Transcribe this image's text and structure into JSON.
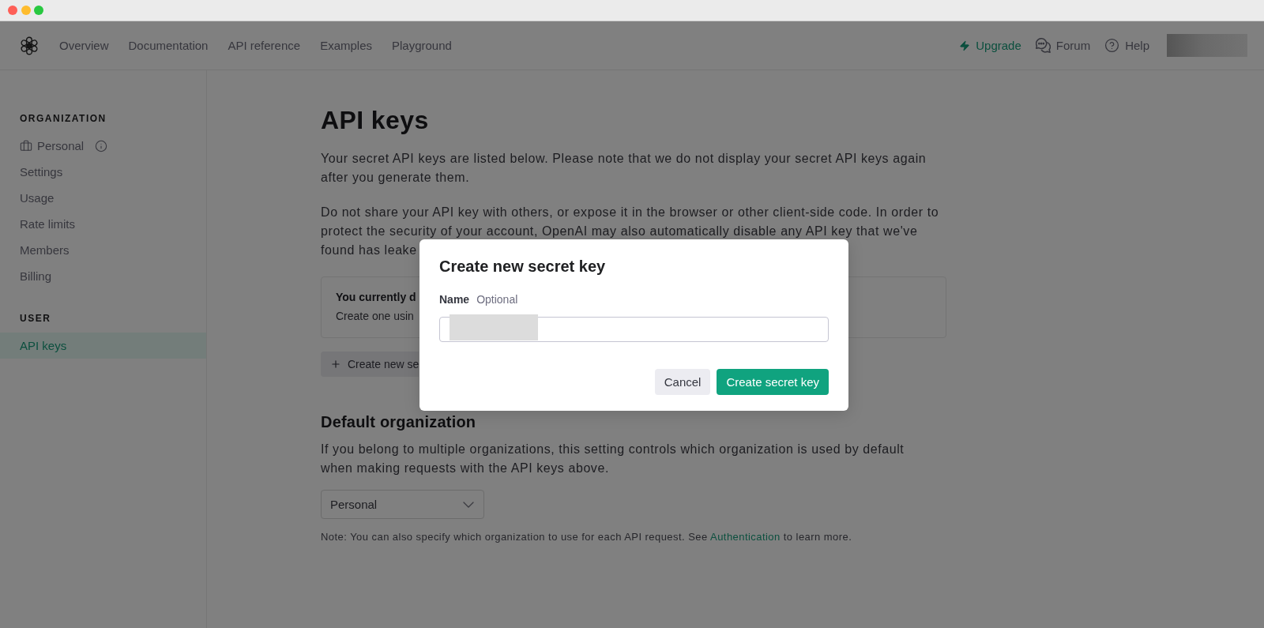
{
  "nav": {
    "links": [
      "Overview",
      "Documentation",
      "API reference",
      "Examples",
      "Playground"
    ],
    "actions": [
      {
        "kind": "upgrade",
        "label": "Upgrade"
      },
      {
        "kind": "forum",
        "label": "Forum"
      },
      {
        "kind": "help",
        "label": "Help"
      }
    ]
  },
  "sidebar": {
    "sections": [
      {
        "heading": "ORGANIZATION",
        "items": [
          {
            "kind": "org",
            "label": "Personal",
            "selected": false
          },
          {
            "kind": "link",
            "label": "Settings",
            "selected": false
          },
          {
            "kind": "link",
            "label": "Usage",
            "selected": false
          },
          {
            "kind": "link",
            "label": "Rate limits",
            "selected": false
          },
          {
            "kind": "link",
            "label": "Members",
            "selected": false
          },
          {
            "kind": "link",
            "label": "Billing",
            "selected": false
          }
        ]
      },
      {
        "heading": "USER",
        "items": [
          {
            "kind": "link",
            "label": "API keys",
            "selected": true
          }
        ]
      }
    ]
  },
  "page": {
    "title": "API keys",
    "intro_lines": [
      "Your secret API keys are listed below. Please note that we do not display your secret API keys again",
      "after you generate them."
    ],
    "warning_lines": [
      "Do not share your API key with others, or expose it in the browser or other client-side code. In order to",
      "protect the security of your account, OpenAI may also automatically disable any API key that we've",
      "found has leake"
    ],
    "notice": {
      "title": "You currently d",
      "text": "Create one usin"
    },
    "create_button": "Create new se",
    "default_org": {
      "heading": "Default organization",
      "lines": [
        "If you belong to multiple organizations, this setting controls which organization is used by default",
        "when making requests with the API keys above."
      ],
      "select": {
        "value": "Personal"
      },
      "note": {
        "before": "Note: You can also specify which organization to use for each API request. See",
        "link": "Authentication",
        "after": "to learn more."
      }
    }
  },
  "modal": {
    "title": "Create new secret key",
    "field": {
      "label": "Name",
      "hint": "Optional"
    },
    "buttons": [
      {
        "kind": "secondary",
        "label": "Cancel"
      },
      {
        "kind": "primary",
        "label": "Create secret key"
      }
    ]
  }
}
